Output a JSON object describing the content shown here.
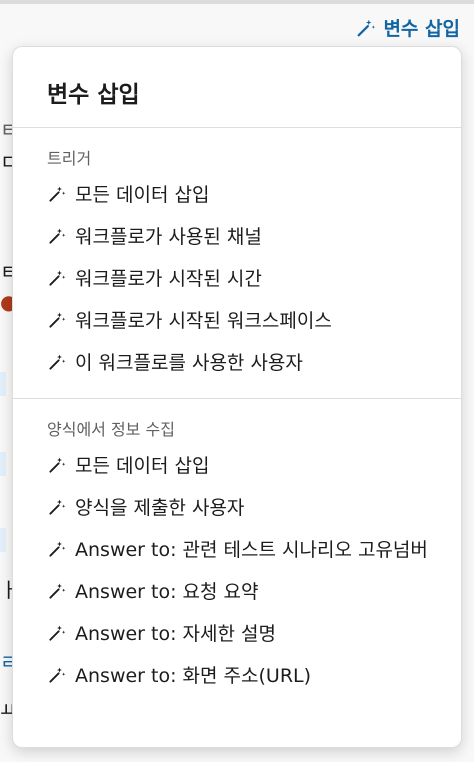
{
  "trigger_button": {
    "label": "변수 삽입",
    "icon": "magic-wand-icon",
    "color": "#1264a3"
  },
  "menu": {
    "title": "변수 삽입",
    "sections": [
      {
        "label": "트리거",
        "items": [
          {
            "label": "모든 데이터 삽입"
          },
          {
            "label": "워크플로가 사용된 채널"
          },
          {
            "label": "워크플로가 시작된 시간"
          },
          {
            "label": "워크플로가 시작된 워크스페이스"
          },
          {
            "label": "이 워크플로를 사용한 사용자"
          }
        ]
      },
      {
        "label": "양식에서 정보 수집",
        "items": [
          {
            "label": "모든 데이터 삽입"
          },
          {
            "label": "양식을 제출한 사용자"
          },
          {
            "label": "Answer to: 관련 테스트 시나리오 고유넘버"
          },
          {
            "label": "Answer to: 요청 요약"
          },
          {
            "label": "Answer to: 자세한 설명"
          },
          {
            "label": "Answer to: 화면 주소(URL)"
          }
        ]
      }
    ]
  }
}
